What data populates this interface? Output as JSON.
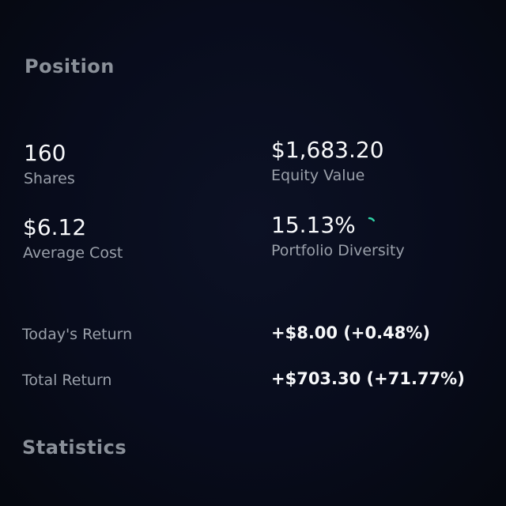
{
  "sections": {
    "position_title": "Position",
    "statistics_title": "Statistics"
  },
  "position": {
    "shares": {
      "value": "160",
      "label": "Shares"
    },
    "equity_value": {
      "value": "$1,683.20",
      "label": "Equity Value"
    },
    "average_cost": {
      "value": "$6.12",
      "label": "Average Cost"
    },
    "portfolio_diversity": {
      "value": "15.13%",
      "label": "Portfolio Diversity",
      "fraction": 0.1513,
      "ring_color": "#2fd3a6"
    }
  },
  "returns": {
    "today": {
      "label": "Today's Return",
      "value": "+$8.00 (+0.48%)"
    },
    "total": {
      "label": "Total Return",
      "value": "+$703.30 (+71.77%)"
    }
  },
  "colors": {
    "background": "#070b1a",
    "heading": "#8a9099",
    "label": "#9aa0aa",
    "value": "#f7f8fa",
    "accent": "#2fd3a6"
  }
}
